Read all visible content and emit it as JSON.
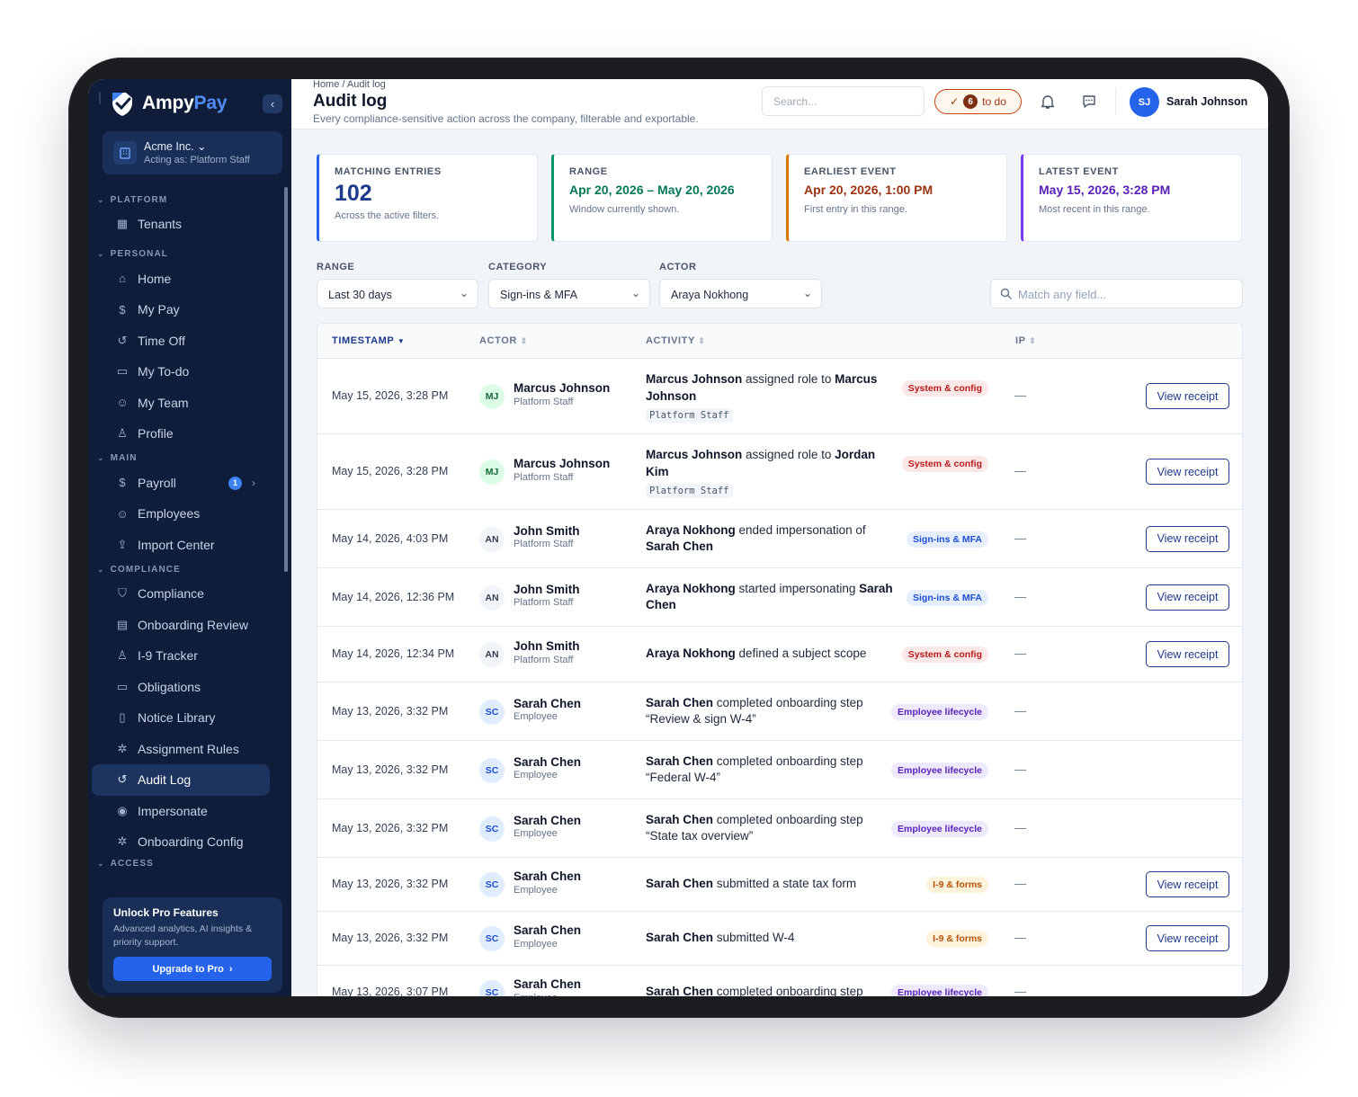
{
  "brand": {
    "name_main": "Ampy",
    "name_accent": "Pay"
  },
  "org": {
    "name": "Acme Inc. ⌄",
    "acting": "Acting as: Platform Staff"
  },
  "nav": {
    "sections": {
      "platform": "PLATFORM",
      "personal": "PERSONAL",
      "main": "MAIN",
      "compliance": "COMPLIANCE",
      "access": "ACCESS"
    },
    "items": {
      "tenants": "Tenants",
      "home": "Home",
      "my_pay": "My Pay",
      "time_off": "Time Off",
      "my_todo": "My To-do",
      "my_team": "My Team",
      "profile": "Profile",
      "payroll": "Payroll",
      "payroll_badge": "1",
      "employees": "Employees",
      "import_center": "Import Center",
      "compliance": "Compliance",
      "onboarding_review": "Onboarding Review",
      "i9_tracker": "I-9 Tracker",
      "obligations": "Obligations",
      "notice_library": "Notice Library",
      "assignment_rules": "Assignment Rules",
      "audit_log": "Audit Log",
      "impersonate": "Impersonate",
      "onboarding_config": "Onboarding Config"
    }
  },
  "promo": {
    "title": "Unlock Pro Features",
    "text": "Advanced analytics, AI insights & priority support.",
    "button": "Upgrade to Pro"
  },
  "header": {
    "breadcrumb": "Home / Audit log",
    "title": "Audit log",
    "subtitle": "Every compliance-sensitive action across the company, filterable and exportable.",
    "search_placeholder": "Search...",
    "todo_count": "6",
    "todo_label": "to do",
    "user_initials": "SJ",
    "user_name": "Sarah Johnson"
  },
  "stats": [
    {
      "label": "MATCHING ENTRIES",
      "value": "102",
      "note": "Across the active filters.",
      "color": "#2563eb"
    },
    {
      "label": "RANGE",
      "value": "Apr 20, 2026 – May 20, 2026",
      "note": "Window currently shown.",
      "color": "#059669"
    },
    {
      "label": "EARLIEST EVENT",
      "value": "Apr 20, 2026, 1:00 PM",
      "note": "First entry in this range.",
      "color": "#d97706"
    },
    {
      "label": "LATEST EVENT",
      "value": "May 15, 2026, 3:28 PM",
      "note": "Most recent in this range.",
      "color": "#7c3aed"
    }
  ],
  "filters": {
    "range_label": "RANGE",
    "range_value": "Last 30 days",
    "category_label": "CATEGORY",
    "category_value": "Sign-ins & MFA",
    "actor_label": "ACTOR",
    "actor_value": "Araya Nokhong",
    "match_placeholder": "Match any field..."
  },
  "table": {
    "columns": {
      "timestamp": "TIMESTAMP",
      "actor": "ACTOR",
      "activity": "ACTIVITY",
      "ip": "IP"
    },
    "receipt_label": "View receipt",
    "rows": [
      {
        "ts": "May 15, 2026, 3:28 PM",
        "initials": "MJ",
        "actor": "Marcus Johnson",
        "role": "Platform Staff",
        "a1": "Marcus Johnson",
        "a2": " assigned role to ",
        "a3": "Marcus Johnson",
        "a4": "",
        "code": "Platform Staff",
        "tag": "System & config",
        "ip": "—"
      },
      {
        "ts": "May 15, 2026, 3:28 PM",
        "initials": "MJ",
        "actor": "Marcus Johnson",
        "role": "Platform Staff",
        "a1": "Marcus Johnson",
        "a2": " assigned role to ",
        "a3": "Jordan Kim",
        "a4": "",
        "code": "Platform Staff",
        "tag": "System & config",
        "ip": "—"
      },
      {
        "ts": "May 14, 2026, 4:03 PM",
        "initials": "AN",
        "actor": "John Smith",
        "role": "Platform Staff",
        "a1": "Araya Nokhong",
        "a2": " ended impersonation of ",
        "a3": "Sarah Chen",
        "a4": "",
        "tag": "Sign-ins & MFA",
        "ip": "—"
      },
      {
        "ts": "May 14, 2026, 12:36 PM",
        "initials": "AN",
        "actor": "John Smith",
        "role": "Platform Staff",
        "a1": "Araya Nokhong",
        "a2": " started impersonating ",
        "a3": "Sarah Chen",
        "a4": "",
        "tag": "Sign-ins & MFA",
        "ip": "—"
      },
      {
        "ts": "May 14, 2026, 12:34 PM",
        "initials": "AN",
        "actor": "John Smith",
        "role": "Platform Staff",
        "a1": "Araya Nokhong",
        "a2": " defined a subject scope",
        "a3": "",
        "a4": "",
        "tag": "System & config",
        "ip": "—"
      },
      {
        "ts": "May 13, 2026, 3:32 PM",
        "initials": "SC",
        "actor": "Sarah Chen",
        "role": "Employee",
        "a1": "Sarah Chen",
        "a2": " completed onboarding step “Review & sign W-4”",
        "a3": "",
        "a4": "",
        "tag": "Employee lifecycle",
        "ip": "—"
      },
      {
        "ts": "May 13, 2026, 3:32 PM",
        "initials": "SC",
        "actor": "Sarah Chen",
        "role": "Employee",
        "a1": "Sarah Chen",
        "a2": " completed onboarding step “Federal W-4”",
        "a3": "",
        "a4": "",
        "tag": "Employee lifecycle",
        "ip": "—"
      },
      {
        "ts": "May 13, 2026, 3:32 PM",
        "initials": "SC",
        "actor": "Sarah Chen",
        "role": "Employee",
        "a1": "Sarah Chen",
        "a2": " completed onboarding step “State tax overview”",
        "a3": "",
        "a4": "",
        "tag": "Employee lifecycle",
        "ip": "—"
      },
      {
        "ts": "May 13, 2026, 3:32 PM",
        "initials": "SC",
        "actor": "Sarah Chen",
        "role": "Employee",
        "a1": "Sarah Chen",
        "a2": " submitted a state tax form",
        "a3": "",
        "a4": "",
        "tag": "I-9 & forms",
        "ip": "—"
      },
      {
        "ts": "May 13, 2026, 3:32 PM",
        "initials": "SC",
        "actor": "Sarah Chen",
        "role": "Employee",
        "a1": "Sarah Chen",
        "a2": " submitted W-4",
        "a3": "",
        "a4": "",
        "tag": "I-9 & forms",
        "ip": "—"
      },
      {
        "ts": "May 13, 2026, 3:07 PM",
        "initials": "SC",
        "actor": "Sarah Chen",
        "role": "Employee",
        "a1": "Sarah Chen",
        "a2": " completed onboarding step",
        "a3": "",
        "a4": "",
        "tag": "Employee lifecycle",
        "ip": "—"
      }
    ]
  }
}
